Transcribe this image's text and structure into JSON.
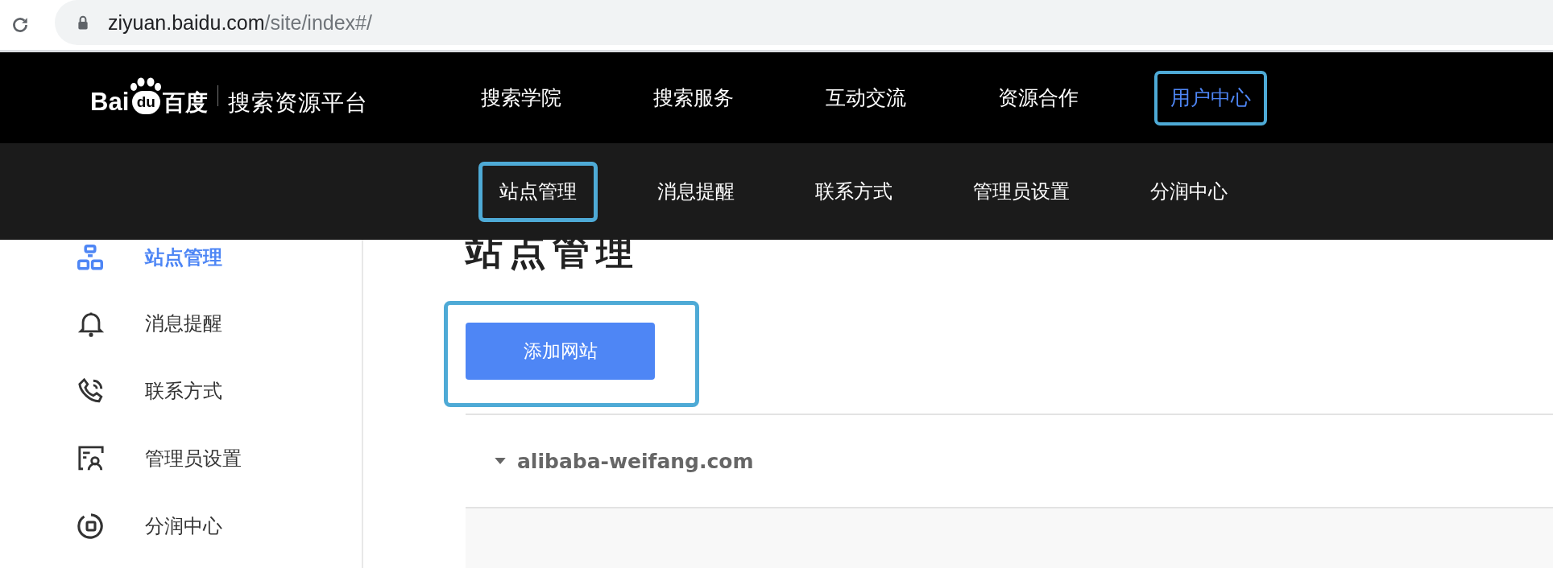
{
  "browser": {
    "url_host": "ziyuan.baidu.com",
    "url_path": "/site/index#/"
  },
  "header": {
    "logo": {
      "latin": "Bai",
      "paw": "du",
      "chinese": "百度"
    },
    "platform": "搜索资源平台",
    "nav": [
      {
        "label": "搜索学院",
        "selected": false,
        "highlighted": false
      },
      {
        "label": "搜索服务",
        "selected": false,
        "highlighted": false
      },
      {
        "label": "互动交流",
        "selected": false,
        "highlighted": false
      },
      {
        "label": "资源合作",
        "selected": false,
        "highlighted": false
      },
      {
        "label": "用户中心",
        "selected": true,
        "highlighted": true
      }
    ]
  },
  "subnav": [
    {
      "label": "站点管理",
      "highlighted": true
    },
    {
      "label": "消息提醒",
      "highlighted": false
    },
    {
      "label": "联系方式",
      "highlighted": false
    },
    {
      "label": "管理员设置",
      "highlighted": false
    },
    {
      "label": "分润中心",
      "highlighted": false
    }
  ],
  "sidebar": {
    "items": [
      {
        "label": "站点管理",
        "kind": "sites",
        "selected": true
      },
      {
        "label": "消息提醒",
        "kind": "bell",
        "selected": false
      },
      {
        "label": "联系方式",
        "kind": "phone",
        "selected": false
      },
      {
        "label": "管理员设置",
        "kind": "admin",
        "selected": false
      },
      {
        "label": "分润中心",
        "kind": "share",
        "selected": false
      }
    ]
  },
  "main": {
    "title": "站点管理",
    "add_button": {
      "label": "添加网站",
      "highlighted": true
    },
    "sites": [
      {
        "domain": "alibaba-weifang.com",
        "expanded": true
      }
    ]
  }
}
